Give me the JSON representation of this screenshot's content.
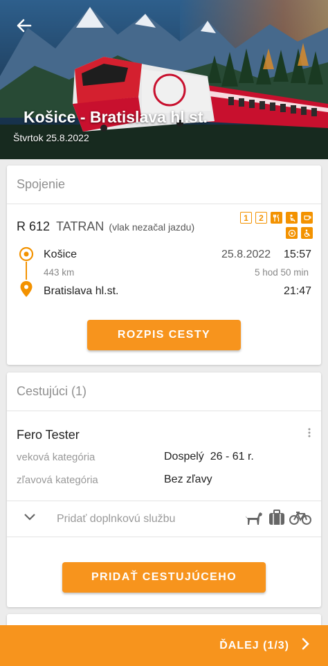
{
  "header": {
    "title": "Košice - Bratislava hl.st.",
    "date": "Štvrtok 25.8.2022"
  },
  "connection": {
    "section_title": "Spojenie",
    "train_type_number": "R 612",
    "train_name": "TATRAN",
    "train_note": "(vlak nezačal jazdu)",
    "amenities": [
      {
        "icon": "first-class-icon",
        "glyph": "1"
      },
      {
        "icon": "second-class-icon",
        "glyph": "2"
      },
      {
        "icon": "restaurant-icon",
        "glyph": "🍴"
      },
      {
        "icon": "couchette-icon",
        "glyph": "🛏"
      },
      {
        "icon": "accessible-boarding-icon",
        "glyph": "♿"
      },
      {
        "icon": "wheelchair-icon",
        "glyph": "♿"
      }
    ],
    "from": {
      "station": "Košice",
      "date": "25.8.2022",
      "time": "15:57"
    },
    "distance": "443 km",
    "duration": "5 hod 50 min",
    "to": {
      "station": "Bratislava hl.st.",
      "time": "21:47"
    },
    "itinerary_button": "ROZPIS CESTY"
  },
  "passengers": {
    "section_title": "Cestujúci (1)",
    "items": [
      {
        "name": "Fero Tester",
        "age_label": "veková kategória",
        "age_value": "Dospelý  26 - 61 r.",
        "discount_label": "zľavová kategória",
        "discount_value": "Bez zľavy"
      }
    ],
    "extra_service_label": "Pridať doplnkovú službu",
    "extra_icons": [
      "dog-icon",
      "luggage-icon",
      "bicycle-icon"
    ],
    "add_button": "PRIDAŤ CESTUJÚCEHO"
  },
  "footer": {
    "next_label": "ĎALEJ (1/3)"
  },
  "colors": {
    "accent": "#f7941d",
    "header_sky": "#2a4a6b"
  }
}
